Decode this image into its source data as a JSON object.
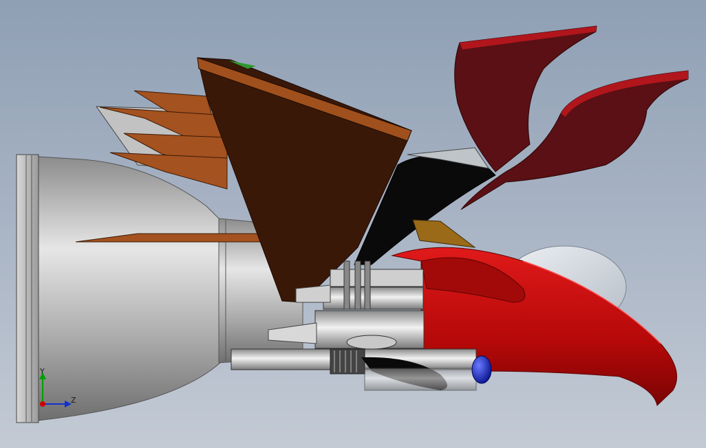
{
  "viewport": {
    "name": "3d-model-viewport",
    "background_top": "#8f9fb4",
    "background_bottom": "#c3cad4"
  },
  "triad": {
    "y_label": "Y",
    "z_label": "Z",
    "colors": {
      "y": "#00a000",
      "z": "#1030d0",
      "x": "#d00000"
    }
  },
  "model": {
    "description_parts": [
      "engine-nozzle",
      "brown-wing-fins",
      "brown-cone-fin",
      "red-feather-fins",
      "black-body-panel",
      "red-beak-head",
      "glass-canopy",
      "gun-barrel",
      "blue-tip-light"
    ],
    "colors": {
      "metal": "#b9b9b9",
      "brown_dark": "#3a1808",
      "brown_fin": "#a4521f",
      "red_feather": "#5a1014",
      "red_head": "#c20c0c",
      "black_panel": "#0a0a0a",
      "glass": "#d5dbe2",
      "blue_light": "#1a2ab8"
    }
  }
}
